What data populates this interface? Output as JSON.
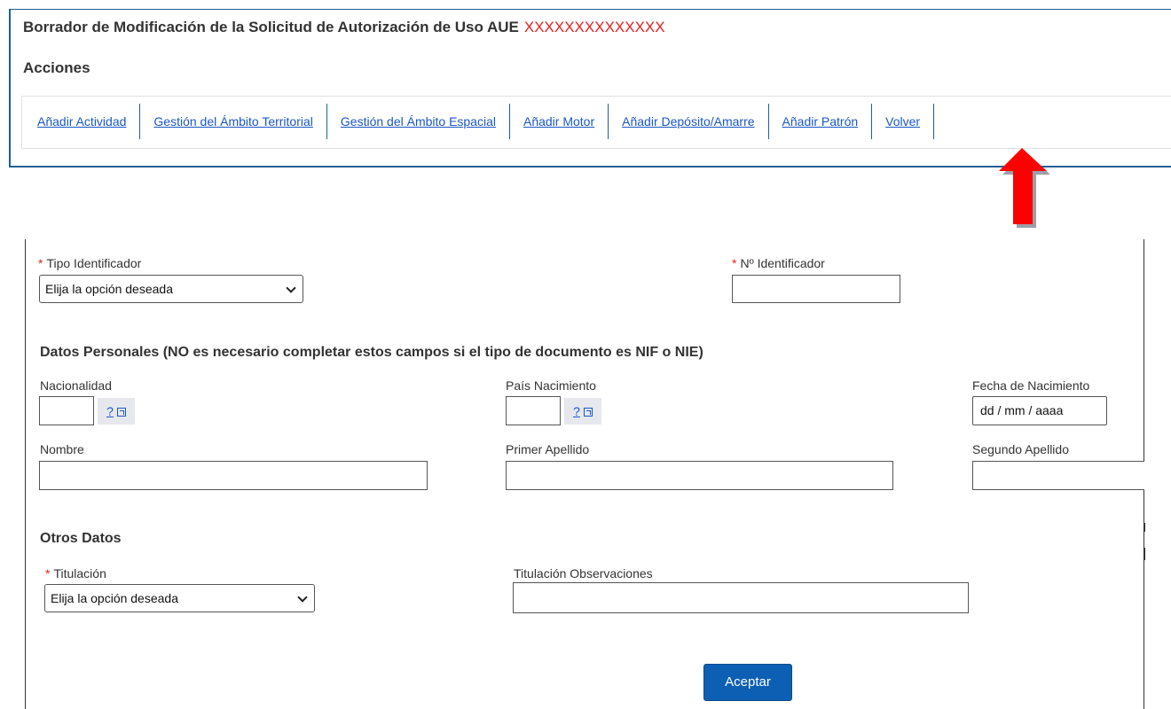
{
  "header": {
    "title": "Borrador de Modificación de la Solicitud de Autorización de Uso AUE",
    "code": "XXXXXXXXXXXXXX",
    "acciones_label": "Acciones",
    "actions": [
      "Añadir Actividad",
      "Gestión del Ámbito Territorial",
      "Gestión del Ámbito Espacial",
      "Añadir Motor",
      "Añadir Depósito/Amarre",
      "Añadir Patrón",
      "Volver"
    ]
  },
  "form": {
    "tipo_identificador": {
      "required_mark": "*",
      "label": "Tipo Identificador",
      "value": "Elija la opción deseada"
    },
    "num_identificador": {
      "required_mark": "*",
      "label": "Nº Identificador",
      "value": ""
    },
    "datos_personales_title": "Datos Personales (NO es necesario completar estos campos si el tipo de documento es NIF o NIE)",
    "nacionalidad": {
      "label": "Nacionalidad",
      "help": "?"
    },
    "pais_nacimiento": {
      "label": "País Nacimiento",
      "help": "?"
    },
    "fecha_nacimiento": {
      "label": "Fecha de Nacimiento",
      "placeholder": "dd / mm / aaaa"
    },
    "nombre": {
      "label": "Nombre"
    },
    "primer_apellido": {
      "label": "Primer Apellido"
    },
    "segundo_apellido": {
      "label": "Segundo Apellido"
    },
    "otros_datos_title": "Otros Datos",
    "titulacion": {
      "required_mark": "*",
      "label": "Titulación",
      "value": "Elija la opción deseada"
    },
    "titulacion_obs": {
      "label": "Titulación Observaciones"
    },
    "accept_button": "Aceptar"
  },
  "colors": {
    "arrow": "#ff0000",
    "primary_button": "#0d5fb3",
    "link": "#1a57c4",
    "required": "#e52222"
  }
}
